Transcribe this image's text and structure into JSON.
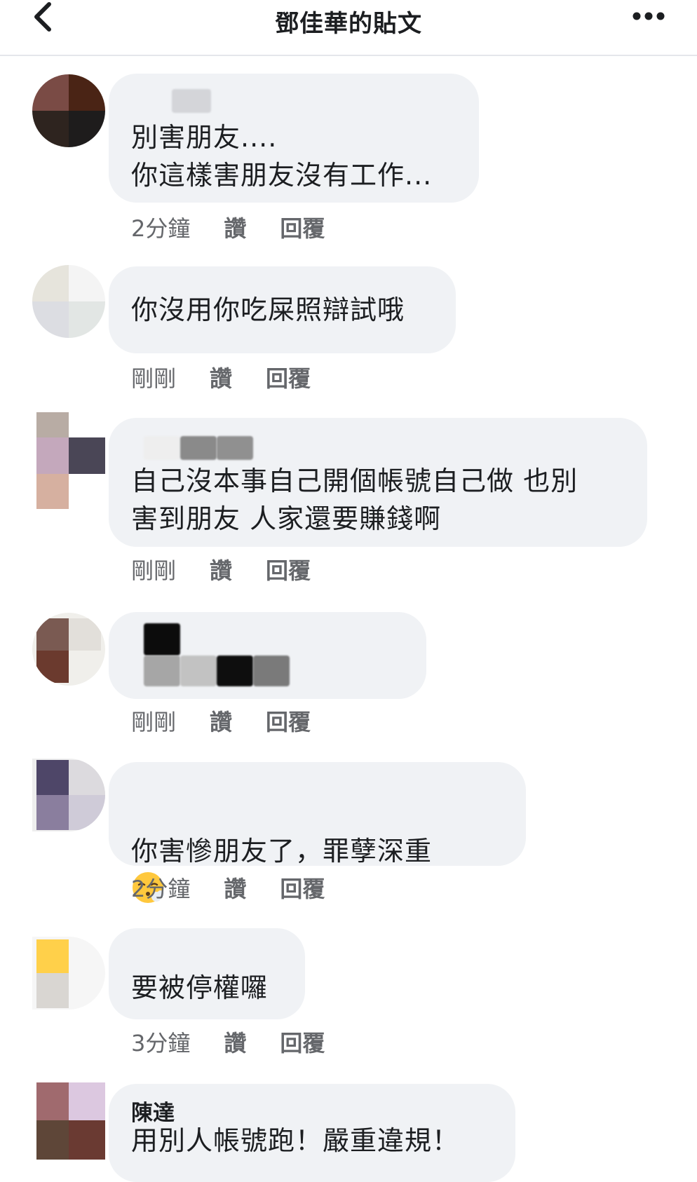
{
  "header": {
    "title": "鄧佳華的貼文",
    "back_icon": "chevron-left-icon",
    "more_icon": "more-horizontal-icon"
  },
  "actions": {
    "like_label": "讚",
    "reply_label": "回覆"
  },
  "comments": [
    {
      "author": "",
      "text": "別害朋友....\n你這樣害朋友沒有工作...",
      "time": "2分鐘"
    },
    {
      "author": "",
      "text": "你沒用你吃屎照辯試哦",
      "time": "剛剛"
    },
    {
      "author": "",
      "text": "自己沒本事自己開個帳號自己做 也別\n害到朋友 人家還要賺錢啊",
      "time": "剛剛"
    },
    {
      "author": "",
      "text": "",
      "time": "剛剛"
    },
    {
      "author": "",
      "text": "你害慘朋友了，罪孽深重",
      "emoji": "face-exhaling-emoji",
      "time": "2分鐘"
    },
    {
      "author": "",
      "text": "要被停權囉",
      "time": "3分鐘"
    },
    {
      "author": "陳達",
      "text": "用別人帳號跑！嚴重違規！",
      "time": ""
    }
  ],
  "colors": {
    "bubble_bg": "#f0f2f5",
    "meta_text": "#65676b",
    "primary_text": "#1c1e21",
    "divider": "#e4e6eb"
  }
}
